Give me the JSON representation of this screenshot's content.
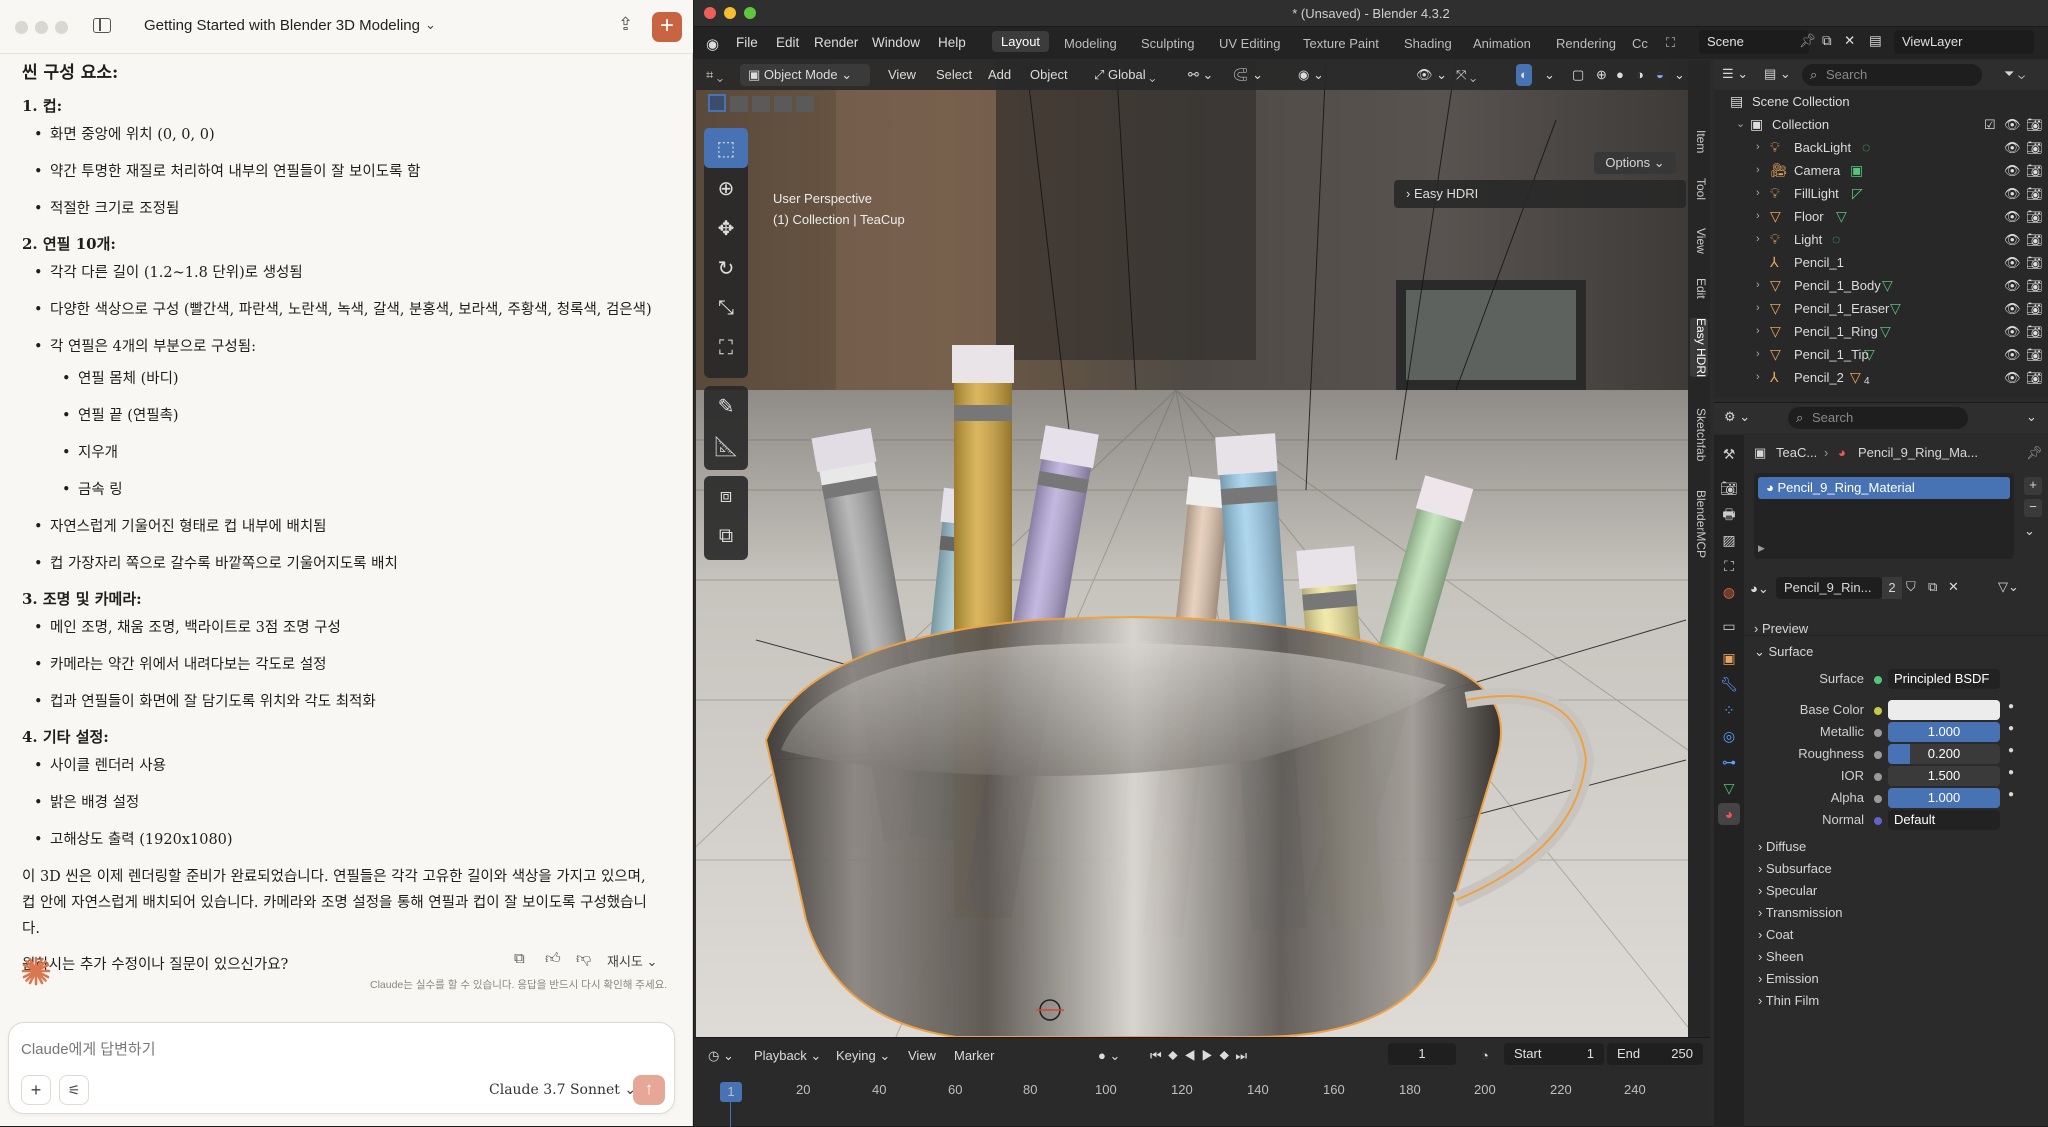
{
  "claude": {
    "title": "Getting Started with Blender 3D Modeling",
    "heading": "씬 구성 요소:",
    "sections": [
      {
        "title": "1. 컵:",
        "items": [
          "화면 중앙에 위치 (0, 0, 0)",
          "약간 투명한 재질로 처리하여 내부의 연필들이 잘 보이도록 함",
          "적절한 크기로 조정됨"
        ]
      },
      {
        "title": "2. 연필 10개:",
        "items": [
          "각각 다른 길이 (1.2~1.8 단위)로 생성됨",
          "다양한 색상으로 구성 (빨간색, 파란색, 노란색, 녹색, 갈색, 분홍색, 보라색, 주황색, 청록색, 검은색)",
          "각 연필은 4개의 부분으로 구성됨:"
        ],
        "subitems": [
          "연필 몸체 (바디)",
          "연필 끝 (연필촉)",
          "지우개",
          "금속 링"
        ],
        "items_after": [
          "자연스럽게 기울어진 형태로 컵 내부에 배치됨",
          "컵 가장자리 쪽으로 갈수록 바깥쪽으로 기울어지도록 배치"
        ]
      },
      {
        "title": "3. 조명 및 카메라:",
        "items": [
          "메인 조명, 채움 조명, 백라이트로 3점 조명 구성",
          "카메라는 약간 위에서 내려다보는 각도로 설정",
          "컵과 연필들이 화면에 잘 담기도록 위치와 각도 최적화"
        ]
      },
      {
        "title": "4. 기타 설정:",
        "items": [
          "사이클 렌더러 사용",
          "밝은 배경 설정",
          "고해상도 출력 (1920x1080)"
        ]
      }
    ],
    "summary": "이 3D 씬은 이제 렌더링할 준비가 완료되었습니다. 연필들은 각각 고유한 길이와 색상을 가지고 있으며, 컵 안에 자연스럽게 배치되어 있습니다. 카메라와 조명 설정을 통해 연필과 컵이 잘 보이도록 구성했습니다.",
    "question": "원하시는 추가 수정이나 질문이 있으신가요?",
    "retry": "재시도",
    "disclaimer": "Claude는 실수를 할 수 있습니다. 응답을 반드시 다시 확인해 주세요.",
    "input_placeholder": "Claude에게 답변하기",
    "model": "Claude 3.7 Sonnet"
  },
  "blender": {
    "window_title": "* (Unsaved) - Blender 4.3.2",
    "menu": [
      "File",
      "Edit",
      "Render",
      "Window",
      "Help"
    ],
    "workspaces": [
      "Layout",
      "Modeling",
      "Sculpting",
      "UV Editing",
      "Texture Paint",
      "Shading",
      "Animation",
      "Rendering",
      "Cc"
    ],
    "scene": "Scene",
    "view_layer": "ViewLayer",
    "viewport": {
      "mode": "Object Mode",
      "menus": [
        "View",
        "Select",
        "Add",
        "Object"
      ],
      "orientation": "Global",
      "options": "Options",
      "info_line1": "User Perspective",
      "info_line2": "(1) Collection | TeaCup",
      "hdri_panel": "Easy HDRI",
      "side_tabs": [
        "Item",
        "Tool",
        "View",
        "Edit",
        "Easy HDRI",
        "Sketchfab",
        "BlenderMCP"
      ]
    },
    "timeline": {
      "menus": [
        "Playback",
        "Keying",
        "View",
        "Marker"
      ],
      "current_frame": "1",
      "start_label": "Start",
      "start": "1",
      "end_label": "End",
      "end": "250",
      "ticks": [
        "1",
        "20",
        "40",
        "60",
        "80",
        "100",
        "120",
        "140",
        "160",
        "180",
        "200",
        "220",
        "240"
      ]
    },
    "outliner": {
      "search": "Search",
      "scene_collection": "Scene Collection",
      "collection": "Collection",
      "objects": [
        "BackLight",
        "Camera",
        "FillLight",
        "Floor",
        "Light",
        "Pencil_1",
        "Pencil_1_Body",
        "Pencil_1_Eraser",
        "Pencil_1_Ring",
        "Pencil_1_Tip",
        "Pencil_2"
      ],
      "pencil2_badge": "4"
    },
    "properties": {
      "search": "Search",
      "breadcrumb_obj": "TeaC...",
      "breadcrumb_mat": "Pencil_9_Ring_Ma...",
      "slot": "Pencil_9_Ring_Material",
      "material_name": "Pencil_9_Rin...",
      "users": "2",
      "preview": "Preview",
      "surface_panel": "Surface",
      "surface_label": "Surface",
      "surface_value": "Principled BSDF",
      "base_color_label": "Base Color",
      "metallic_label": "Metallic",
      "metallic": "1.000",
      "roughness_label": "Roughness",
      "roughness": "0.200",
      "ior_label": "IOR",
      "ior": "1.500",
      "alpha_label": "Alpha",
      "alpha": "1.000",
      "normal_label": "Normal",
      "normal": "Default",
      "subpanels": [
        "Diffuse",
        "Subsurface",
        "Specular",
        "Transmission",
        "Coat",
        "Sheen",
        "Emission",
        "Thin Film"
      ]
    }
  },
  "colors": {
    "accent": "#4772b3",
    "claude_orange": "#c96442"
  }
}
